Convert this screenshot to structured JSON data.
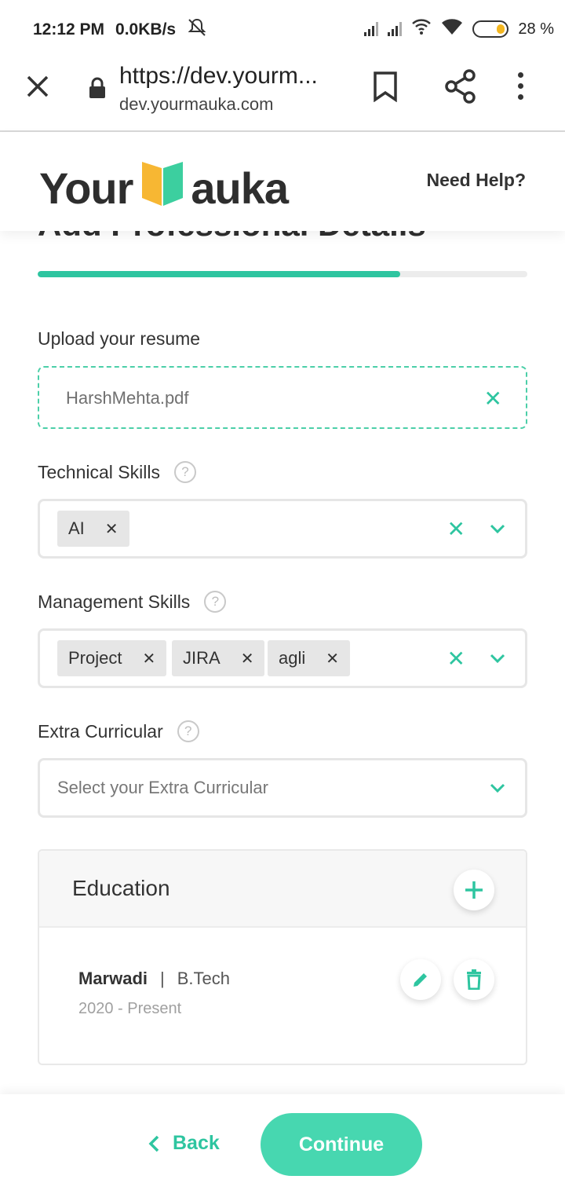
{
  "status_bar": {
    "time": "12:12 PM",
    "speed": "0.0KB/s",
    "battery": "28 %"
  },
  "browser": {
    "url_title": "https://dev.yourm...",
    "url_domain": "dev.yourmauka.com"
  },
  "header": {
    "logo_left": "Your",
    "logo_right": "auka",
    "help": "Need Help?"
  },
  "page": {
    "title": "Add Professional Details",
    "progress_percent": 74
  },
  "resume": {
    "label": "Upload your resume",
    "file_name": "HarshMehta.pdf"
  },
  "technical_skills": {
    "label": "Technical Skills",
    "chips": [
      "AI"
    ]
  },
  "management_skills": {
    "label": "Management Skills",
    "chips": [
      "Project",
      "JIRA",
      "agli"
    ]
  },
  "extra_curricular": {
    "label": "Extra Curricular",
    "placeholder": "Select your Extra Curricular"
  },
  "education": {
    "title": "Education",
    "entries": [
      {
        "institution": "Marwadi",
        "separator": "|",
        "degree": "B.Tech",
        "years": "2020 - Present"
      }
    ]
  },
  "footer": {
    "back": "Back",
    "continue": "Continue"
  },
  "colors": {
    "accent": "#2ec5a0",
    "button": "#47d7b0"
  }
}
